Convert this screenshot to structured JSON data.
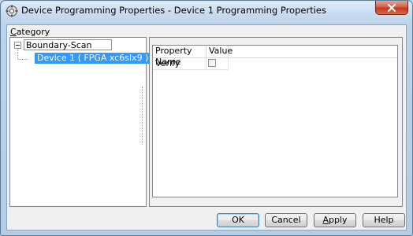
{
  "window": {
    "title": "Device Programming Properties - Device 1 Programming Properties"
  },
  "category": {
    "label_first": "C",
    "label_rest": "ategory",
    "tree": {
      "root": "Boundary-Scan",
      "child": "Device 1 ( FPGA xc6slx9 )"
    }
  },
  "properties": {
    "columns": [
      "Property Name",
      "Value"
    ],
    "rows": [
      {
        "name": "Verify",
        "checked": false
      }
    ]
  },
  "buttons": {
    "ok": "OK",
    "cancel": "Cancel",
    "apply_first": "A",
    "apply_rest": "pply",
    "help": "Help"
  },
  "icons": {
    "app": "device-programming-icon",
    "close": "close-icon",
    "tree_toggle": "tree-collapse-icon"
  }
}
